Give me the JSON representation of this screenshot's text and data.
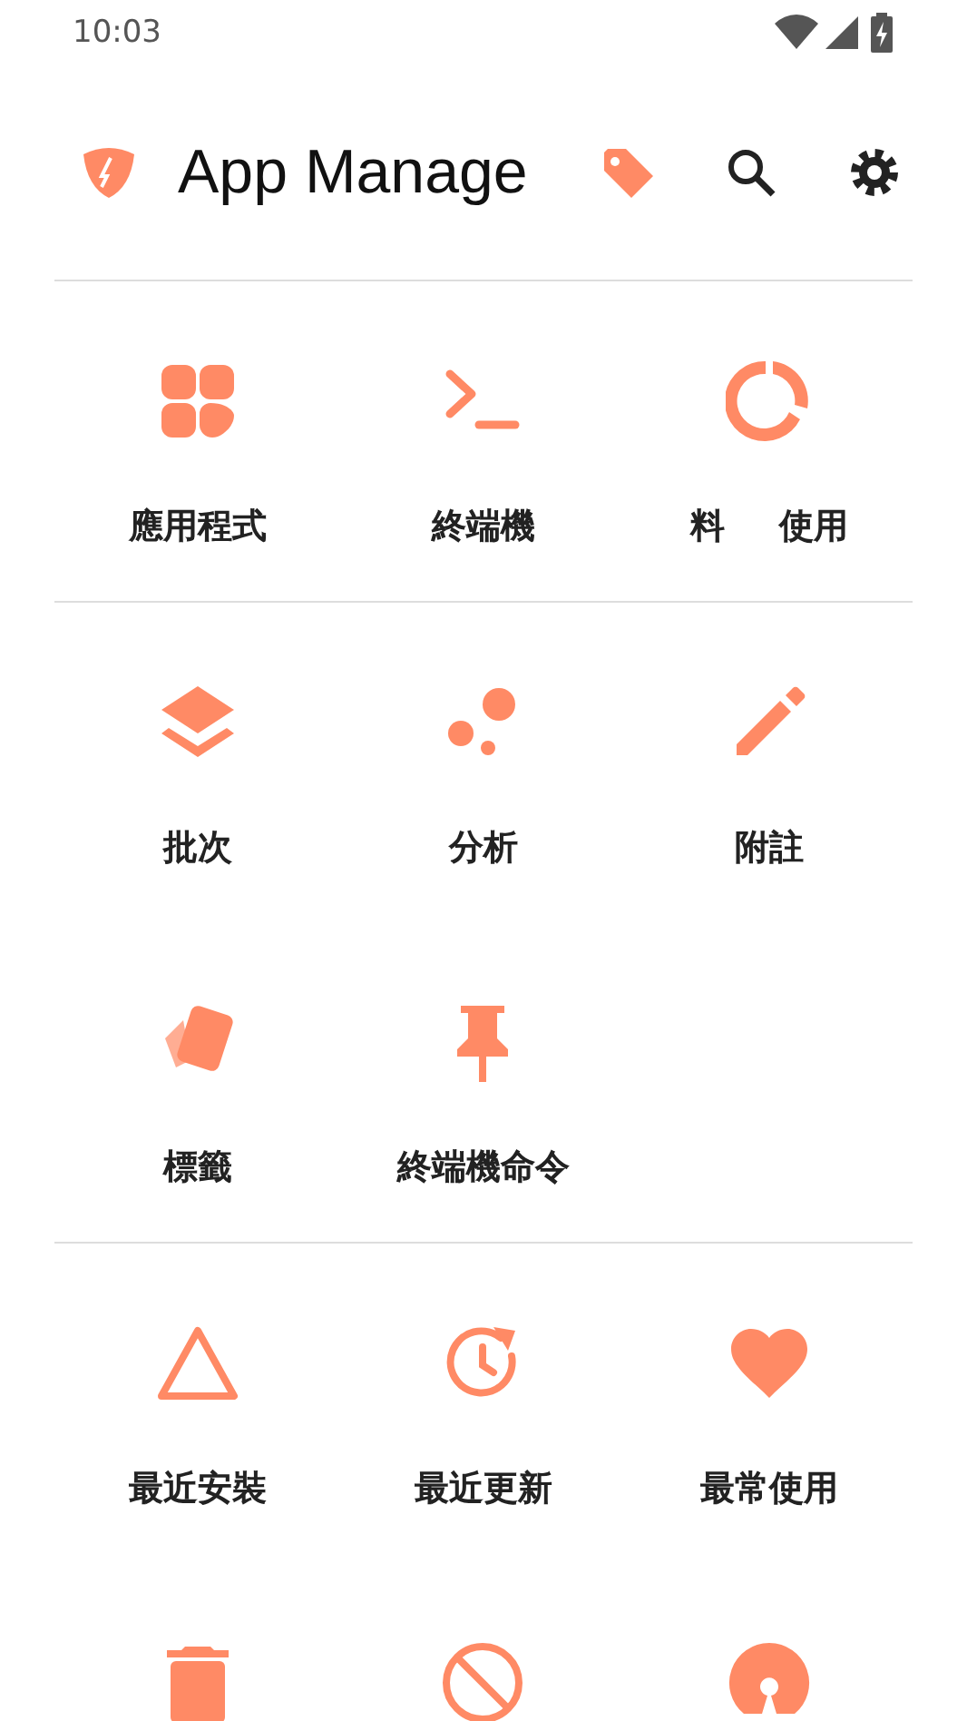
{
  "status_bar": {
    "time": "10:03"
  },
  "toolbar": {
    "title": "App Manage"
  },
  "sections": [
    {
      "tiles": [
        {
          "kind": "labelled",
          "labels": [
            "應用程式"
          ]
        },
        {
          "kind": "labelled",
          "labels": [
            "終端機"
          ]
        },
        {
          "kind": "labelled",
          "labels": [
            "料",
            "使用"
          ]
        }
      ]
    },
    {
      "tiles": [
        {
          "kind": "labelled",
          "labels": [
            "批次"
          ]
        },
        {
          "kind": "labelled",
          "labels": [
            "分析"
          ]
        },
        {
          "kind": "labelled",
          "labels": [
            "附註"
          ]
        },
        {
          "kind": "labelled",
          "labels": [
            "標籤"
          ]
        },
        {
          "kind": "labelled",
          "labels": [
            "終端機命令"
          ]
        }
      ]
    },
    {
      "tiles": [
        {
          "kind": "labelled",
          "labels": [
            "最近安裝"
          ]
        },
        {
          "kind": "labelled",
          "labels": [
            "最近更新"
          ]
        },
        {
          "kind": "labelled",
          "labels": [
            "最常使用"
          ]
        },
        {
          "kind": "icon_only"
        },
        {
          "kind": "icon_only"
        },
        {
          "kind": "icon_only"
        }
      ]
    }
  ]
}
